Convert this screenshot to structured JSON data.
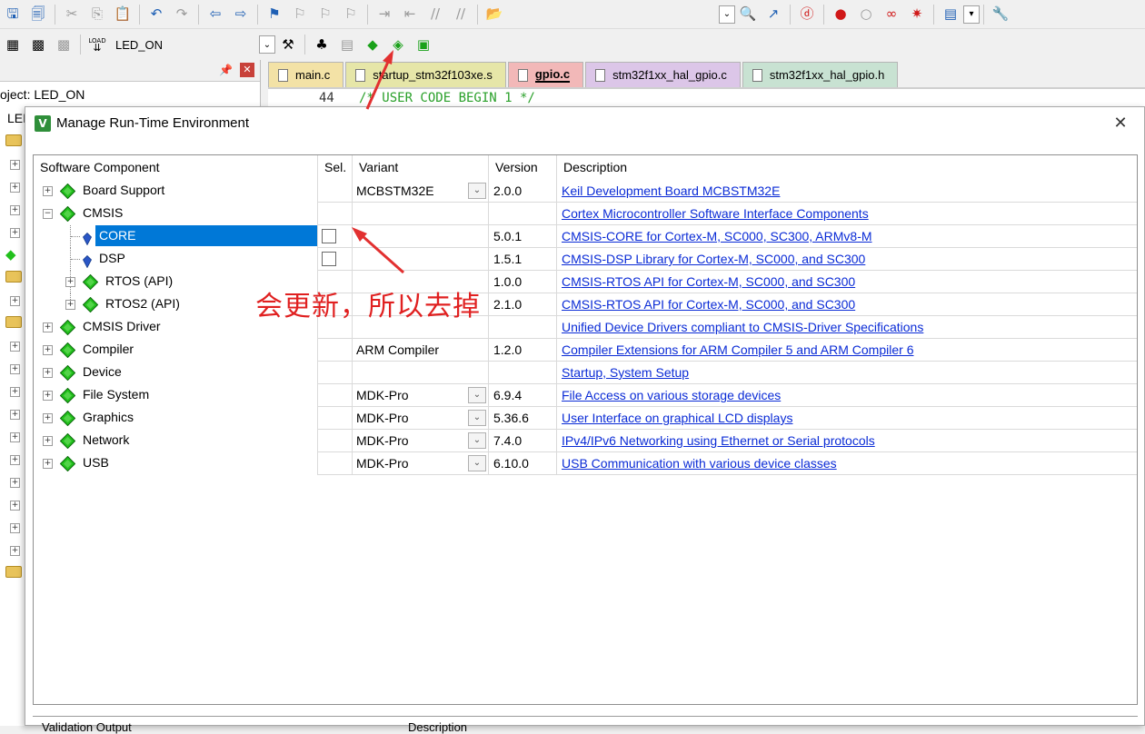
{
  "toolbar2": {
    "target_name": "LED_ON",
    "load_label": "LOAD"
  },
  "project_panel": {
    "project_label": "oject: LED_ON",
    "project_cut": "LEI"
  },
  "tabs": [
    {
      "label": "main.c",
      "color": "#f3e2a6",
      "bold": false
    },
    {
      "label": "startup_stm32f103xe.s",
      "color": "#e6e6a8",
      "bold": false
    },
    {
      "label": "gpio.c",
      "color": "#f2b8b8",
      "bold": true
    },
    {
      "label": "stm32f1xx_hal_gpio.c",
      "color": "#dcc6e8",
      "bold": false
    },
    {
      "label": "stm32f1xx_hal_gpio.h",
      "color": "#c8e2d2",
      "bold": false
    }
  ],
  "editor": {
    "line_number": "44",
    "code": "/* USER CODE BEGIN 1 */"
  },
  "dialog": {
    "title": "Manage Run-Time Environment",
    "close_glyph": "✕"
  },
  "grid": {
    "headers": {
      "component": "Software Component",
      "sel": "Sel.",
      "variant": "Variant",
      "version": "Version",
      "description": "Description"
    },
    "rows": [
      {
        "name": "Board Support",
        "level": 0,
        "expander": "+",
        "icon": "gem",
        "selected": false,
        "checkbox": false,
        "variant": "MCBSTM32E",
        "dropdown": true,
        "version": "2.0.0",
        "description": "Keil Development Board MCBSTM32E"
      },
      {
        "name": "CMSIS",
        "level": 0,
        "expander": "−",
        "icon": "gem",
        "selected": false,
        "checkbox": false,
        "variant": "",
        "dropdown": false,
        "version": "",
        "description": "Cortex Microcontroller Software Interface Components"
      },
      {
        "name": "CORE",
        "level": 1,
        "expander": "",
        "icon": "leaf",
        "selected": true,
        "checkbox": true,
        "variant": "",
        "dropdown": false,
        "version": "5.0.1",
        "description": "CMSIS-CORE for Cortex-M, SC000, SC300, ARMv8-M"
      },
      {
        "name": "DSP",
        "level": 1,
        "expander": "",
        "icon": "leaf",
        "selected": false,
        "checkbox": true,
        "variant": "",
        "dropdown": false,
        "version": "1.5.1",
        "description": "CMSIS-DSP Library for Cortex-M, SC000, and SC300"
      },
      {
        "name": "RTOS (API)",
        "level": 1,
        "expander": "+",
        "icon": "gem",
        "selected": false,
        "checkbox": false,
        "variant": "",
        "dropdown": false,
        "version": "1.0.0",
        "description": "CMSIS-RTOS API for Cortex-M, SC000, and SC300"
      },
      {
        "name": "RTOS2 (API)",
        "level": 1,
        "expander": "+",
        "icon": "gem",
        "selected": false,
        "checkbox": false,
        "variant": "",
        "dropdown": false,
        "version": "2.1.0",
        "description": "CMSIS-RTOS API for Cortex-M, SC000, and SC300"
      },
      {
        "name": "CMSIS Driver",
        "level": 0,
        "expander": "+",
        "icon": "gem",
        "selected": false,
        "checkbox": false,
        "variant": "",
        "dropdown": false,
        "version": "",
        "description": "Unified Device Drivers compliant to CMSIS-Driver Specifications"
      },
      {
        "name": "Compiler",
        "level": 0,
        "expander": "+",
        "icon": "gem",
        "selected": false,
        "checkbox": false,
        "variant": "ARM Compiler",
        "dropdown": false,
        "version": "1.2.0",
        "description": "Compiler Extensions for ARM Compiler 5 and ARM Compiler 6"
      },
      {
        "name": "Device",
        "level": 0,
        "expander": "+",
        "icon": "gem",
        "selected": false,
        "checkbox": false,
        "variant": "",
        "dropdown": false,
        "version": "",
        "description": "Startup, System Setup"
      },
      {
        "name": "File System",
        "level": 0,
        "expander": "+",
        "icon": "gem",
        "selected": false,
        "checkbox": false,
        "variant": "MDK-Pro",
        "dropdown": true,
        "version": "6.9.4",
        "description": "File Access on various storage devices"
      },
      {
        "name": "Graphics",
        "level": 0,
        "expander": "+",
        "icon": "gem",
        "selected": false,
        "checkbox": false,
        "variant": "MDK-Pro",
        "dropdown": true,
        "version": "5.36.6",
        "description": "User Interface on graphical LCD displays"
      },
      {
        "name": "Network",
        "level": 0,
        "expander": "+",
        "icon": "gem",
        "selected": false,
        "checkbox": false,
        "variant": "MDK-Pro",
        "dropdown": true,
        "version": "7.4.0",
        "description": "IPv4/IPv6 Networking using Ethernet or Serial protocols"
      },
      {
        "name": "USB",
        "level": 0,
        "expander": "+",
        "icon": "gem",
        "selected": false,
        "checkbox": false,
        "variant": "MDK-Pro",
        "dropdown": true,
        "version": "6.10.0",
        "description": "USB Communication with various device classes"
      }
    ]
  },
  "validation": {
    "output_label": "Validation Output",
    "description_label": "Description"
  },
  "annotation": {
    "text": "会更新，所以去掉",
    "color": "#e02020"
  },
  "colors": {
    "selection": "#0078d7",
    "link": "#0a2bd6",
    "gem_green": "#22c01c",
    "leaf_blue": "#2a56c6"
  }
}
